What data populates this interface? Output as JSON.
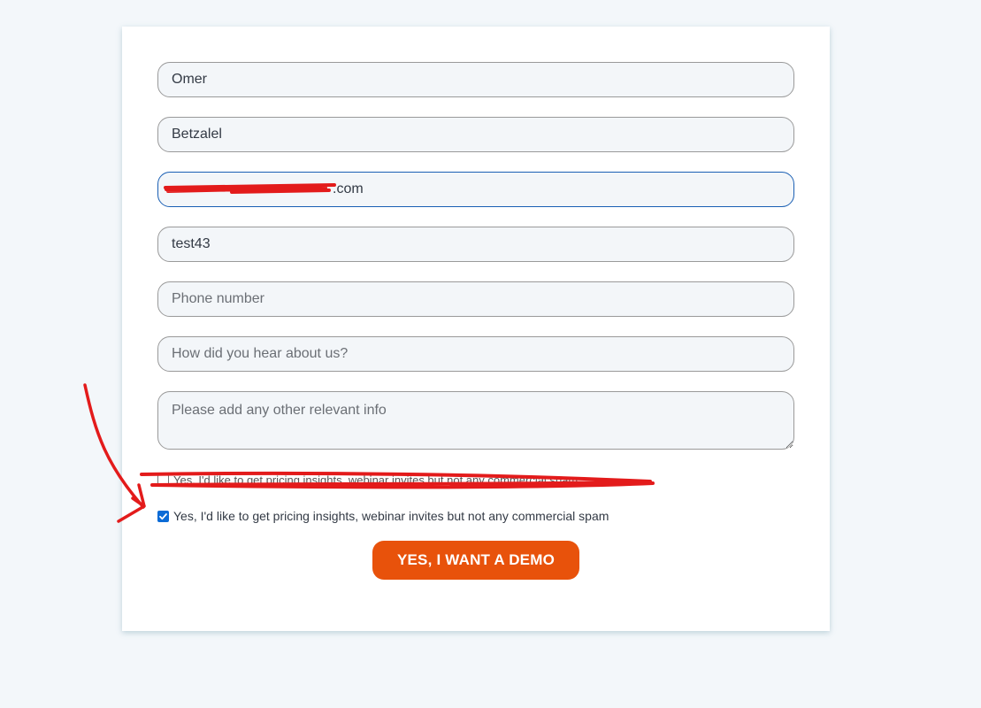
{
  "form": {
    "first_name": "Omer",
    "last_name": "Betzalel",
    "email_visible_suffix": ".com",
    "company": "test43",
    "phone_placeholder": "Phone number",
    "source_placeholder": "How did you hear about us?",
    "info_placeholder": "Please add any other relevant info",
    "consent_obscured_label": "Yes, I'd like to get pricing insights, webinar invites but not any commercial spam",
    "consent_label": "Yes, I'd like to get pricing insights, webinar invites but not any commercial spam",
    "consent_checked": true,
    "submit_label": "YES, I WANT A DEMO"
  },
  "annotation_color": "#e31b1b",
  "colors": {
    "accent": "#e8520b",
    "focus_border": "#1a5fb4",
    "checkbox": "#0b6bd6"
  }
}
